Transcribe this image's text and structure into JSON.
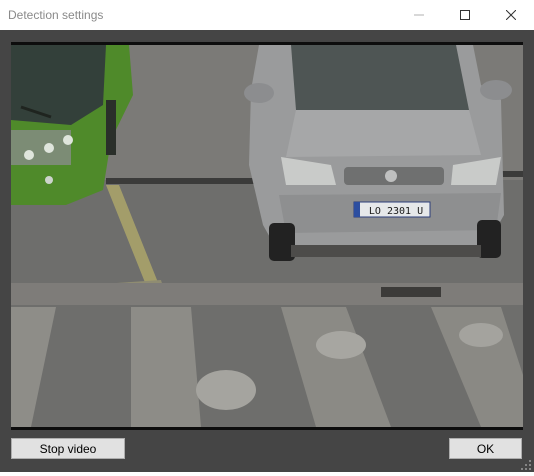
{
  "window": {
    "title": "Detection settings"
  },
  "titlebar": {
    "minimize_icon": "minimize-icon",
    "maximize_icon": "maximize-icon",
    "close_icon": "close-icon"
  },
  "video": {
    "plate_text": "LO 2301 U",
    "description_colors": {
      "asphalt": "#6f6f6d",
      "bus": "#4f8a2a",
      "car": "#9a9b9c"
    }
  },
  "buttons": {
    "stop_video": "Stop video",
    "ok": "OK"
  }
}
